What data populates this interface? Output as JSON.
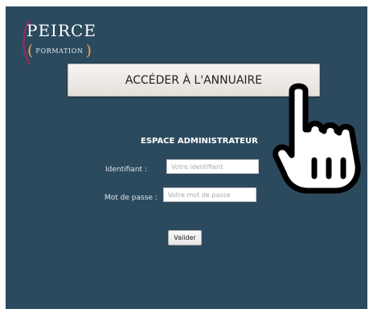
{
  "logo": {
    "name": "PEIRCE",
    "subtitle": "FORMATION",
    "paren_open": "(",
    "paren_close": ")",
    "accent_color": "#f0a840"
  },
  "directory_button": {
    "label": "ACCÉDER À L'ANNUAIRE"
  },
  "admin": {
    "title": "ESPACE ADMINISTRATEUR",
    "identifier_label": "Identifiant :",
    "identifier_placeholder": "Votre identifiant",
    "password_label": "Mot de passe :",
    "password_placeholder": "Votre mot de passe",
    "submit_label": "Valider"
  },
  "colors": {
    "background": "#2c4a5e"
  },
  "cursor_icon": "pointing-hand"
}
